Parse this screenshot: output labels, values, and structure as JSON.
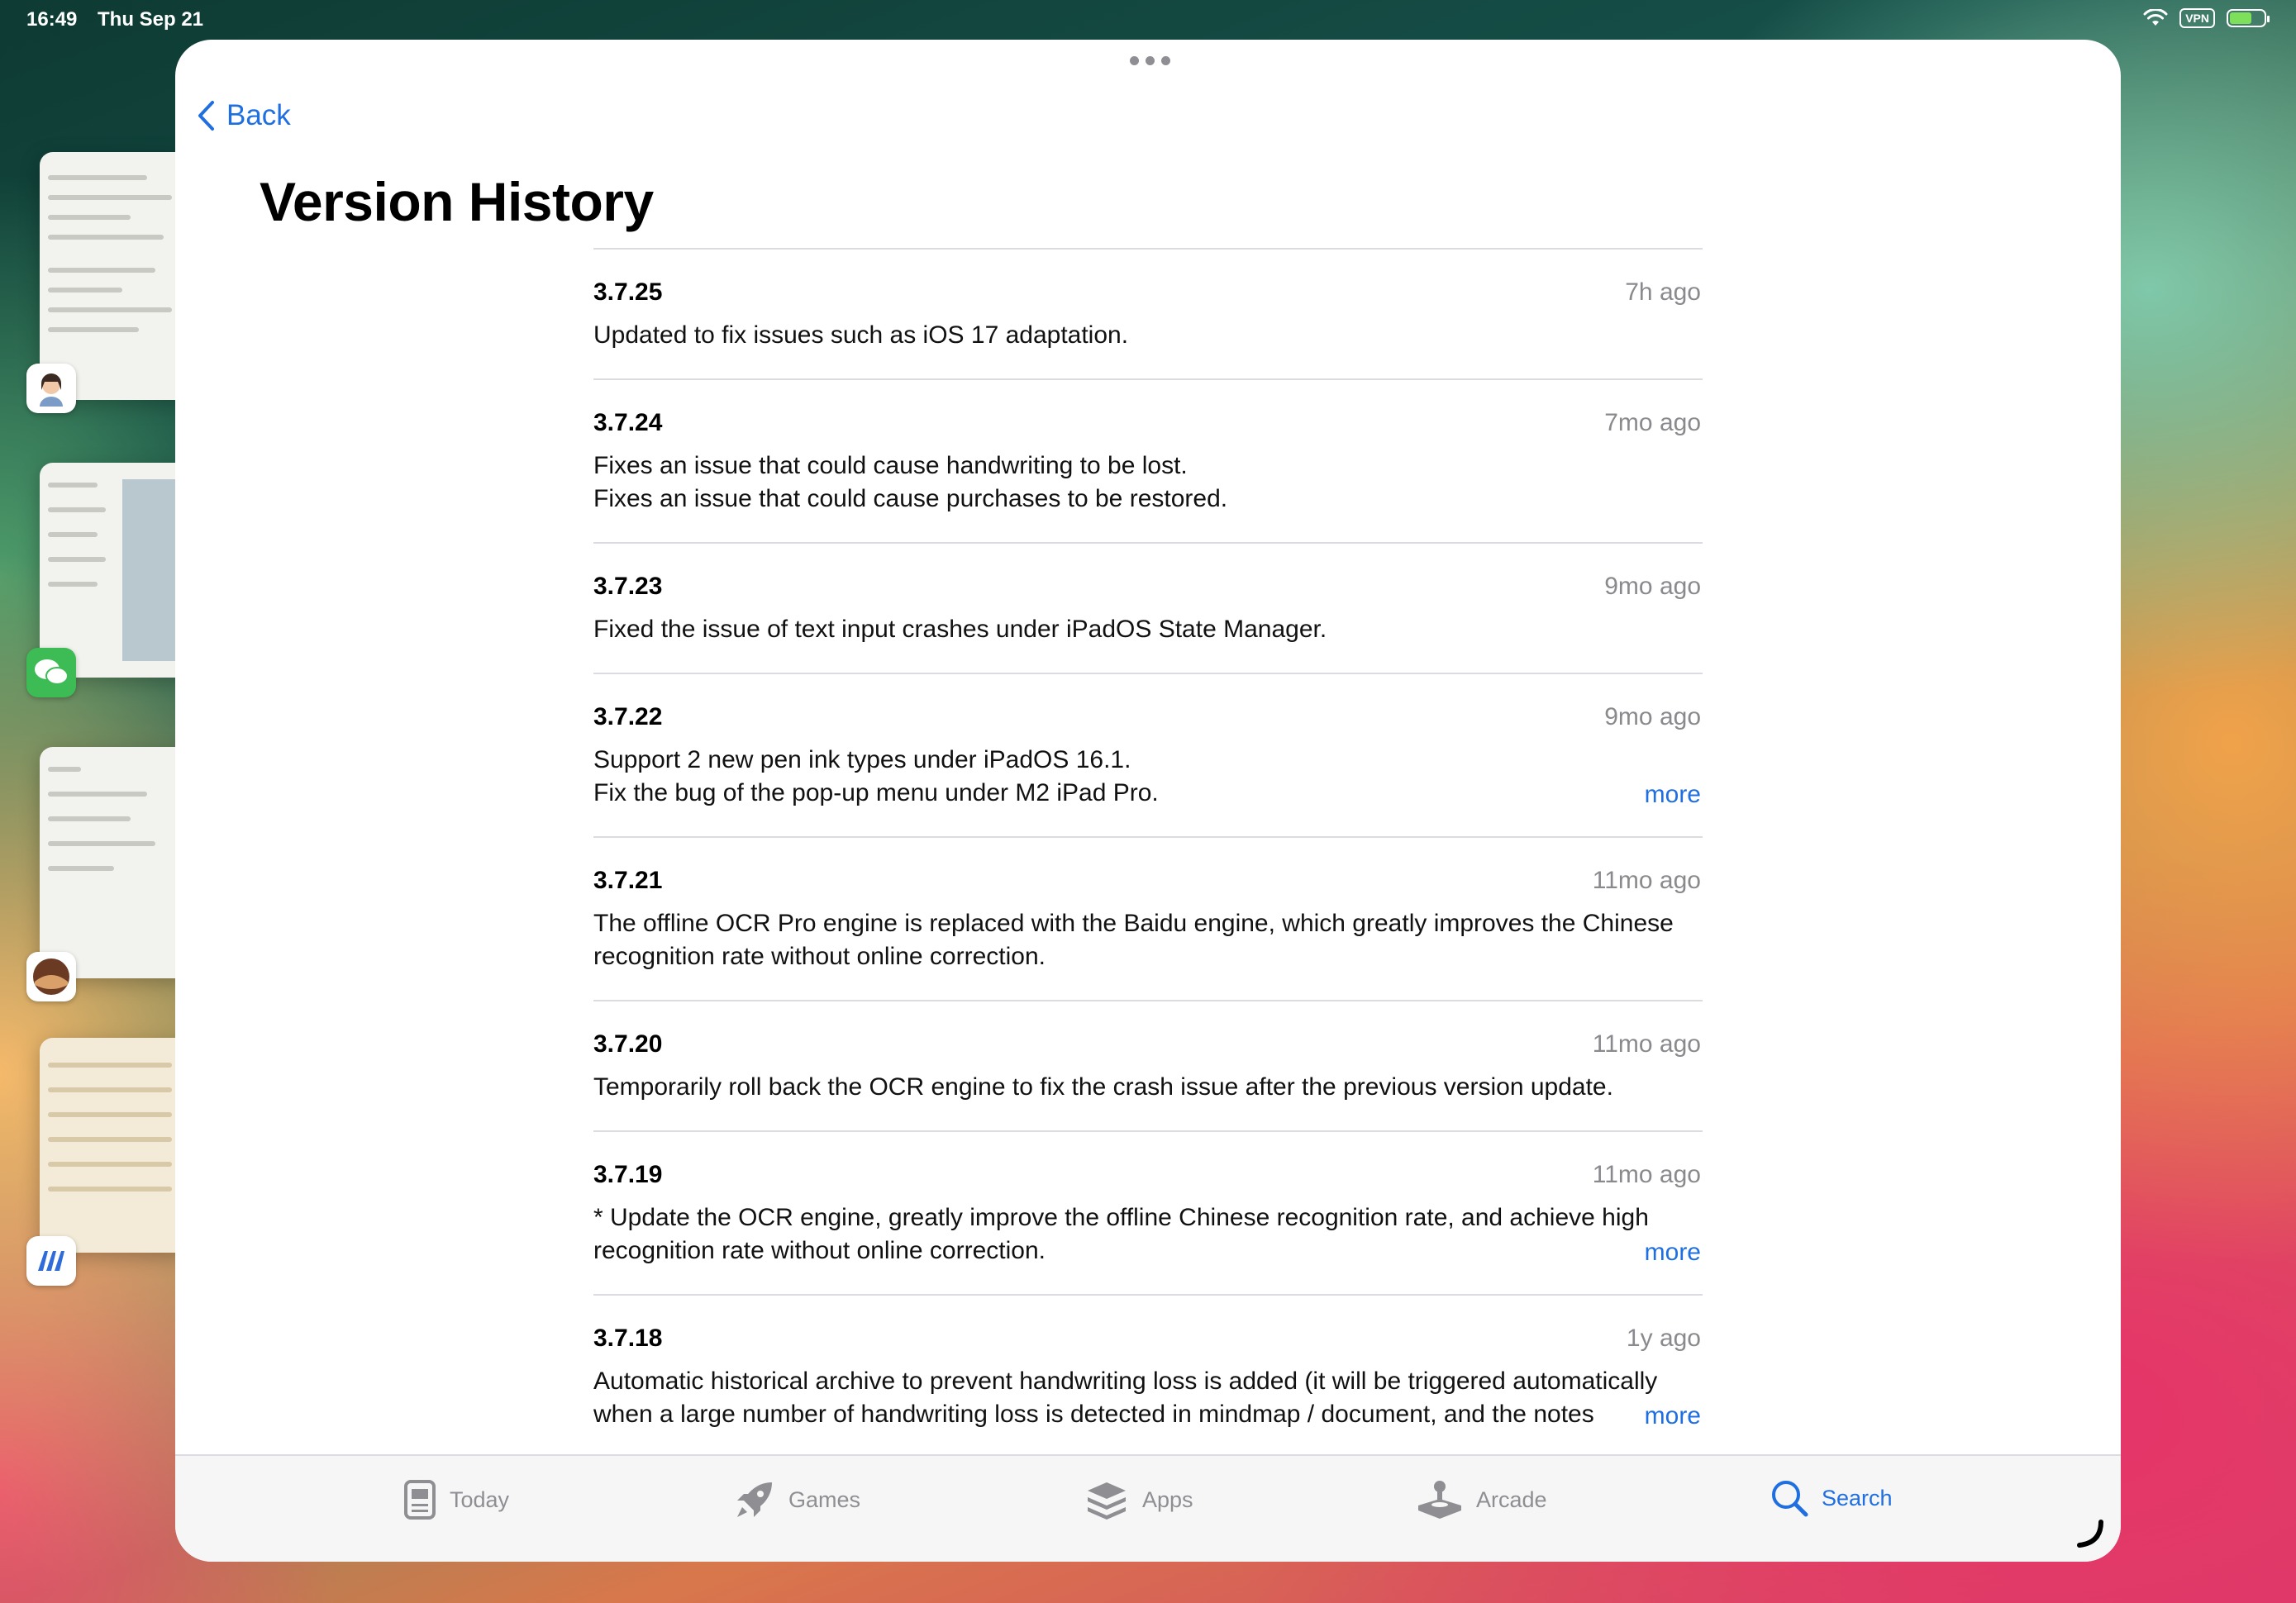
{
  "status_bar": {
    "time": "16:49",
    "date": "Thu Sep 21",
    "vpn": "VPN"
  },
  "nav": {
    "back_label": "Back",
    "title": "Version History"
  },
  "versions": [
    {
      "version": "3.7.25",
      "date": "7h ago",
      "lines": [
        "Updated to fix issues such as iOS 17 adaptation."
      ],
      "more": ""
    },
    {
      "version": "3.7.24",
      "date": "7mo ago",
      "lines": [
        "Fixes an issue that could cause handwriting to be lost.",
        "Fixes an issue that could cause purchases to be restored."
      ],
      "more": ""
    },
    {
      "version": "3.7.23",
      "date": "9mo ago",
      "lines": [
        "Fixed the issue of text input crashes under iPadOS State Manager."
      ],
      "more": ""
    },
    {
      "version": "3.7.22",
      "date": "9mo ago",
      "lines": [
        "Support 2 new pen ink types under iPadOS 16.1.",
        "Fix the bug of the pop-up menu under M2 iPad Pro."
      ],
      "more": "more"
    },
    {
      "version": "3.7.21",
      "date": "11mo ago",
      "lines": [
        "The offline OCR Pro engine is replaced with the Baidu engine, which greatly improves the Chinese",
        "recognition rate without online correction."
      ],
      "more": ""
    },
    {
      "version": "3.7.20",
      "date": "11mo ago",
      "lines": [
        "Temporarily roll back the OCR engine to fix the crash issue after the previous version update."
      ],
      "more": ""
    },
    {
      "version": "3.7.19",
      "date": "11mo ago",
      "lines": [
        "* Update the OCR engine, greatly improve the offline Chinese recognition rate, and achieve high",
        "recognition rate without online correction."
      ],
      "more": "more"
    },
    {
      "version": "3.7.18",
      "date": "1y ago",
      "lines": [
        "Automatic historical archive to prevent handwriting loss is added (it will be triggered automatically",
        "when a large number of handwriting loss is detected in mindmap / document, and the notes"
      ],
      "more": "more"
    }
  ],
  "tab_bar": {
    "tabs": [
      {
        "label": "Today",
        "icon": "today-icon",
        "active": false
      },
      {
        "label": "Games",
        "icon": "rocket-icon",
        "active": false
      },
      {
        "label": "Apps",
        "icon": "apps-stack-icon",
        "active": false
      },
      {
        "label": "Arcade",
        "icon": "joystick-icon",
        "active": false
      },
      {
        "label": "Search",
        "icon": "search-icon",
        "active": true
      }
    ]
  },
  "colors": {
    "accent": "#1f6fe0",
    "secondary_text": "#8a8a8e",
    "separator": "#dcdce0"
  }
}
